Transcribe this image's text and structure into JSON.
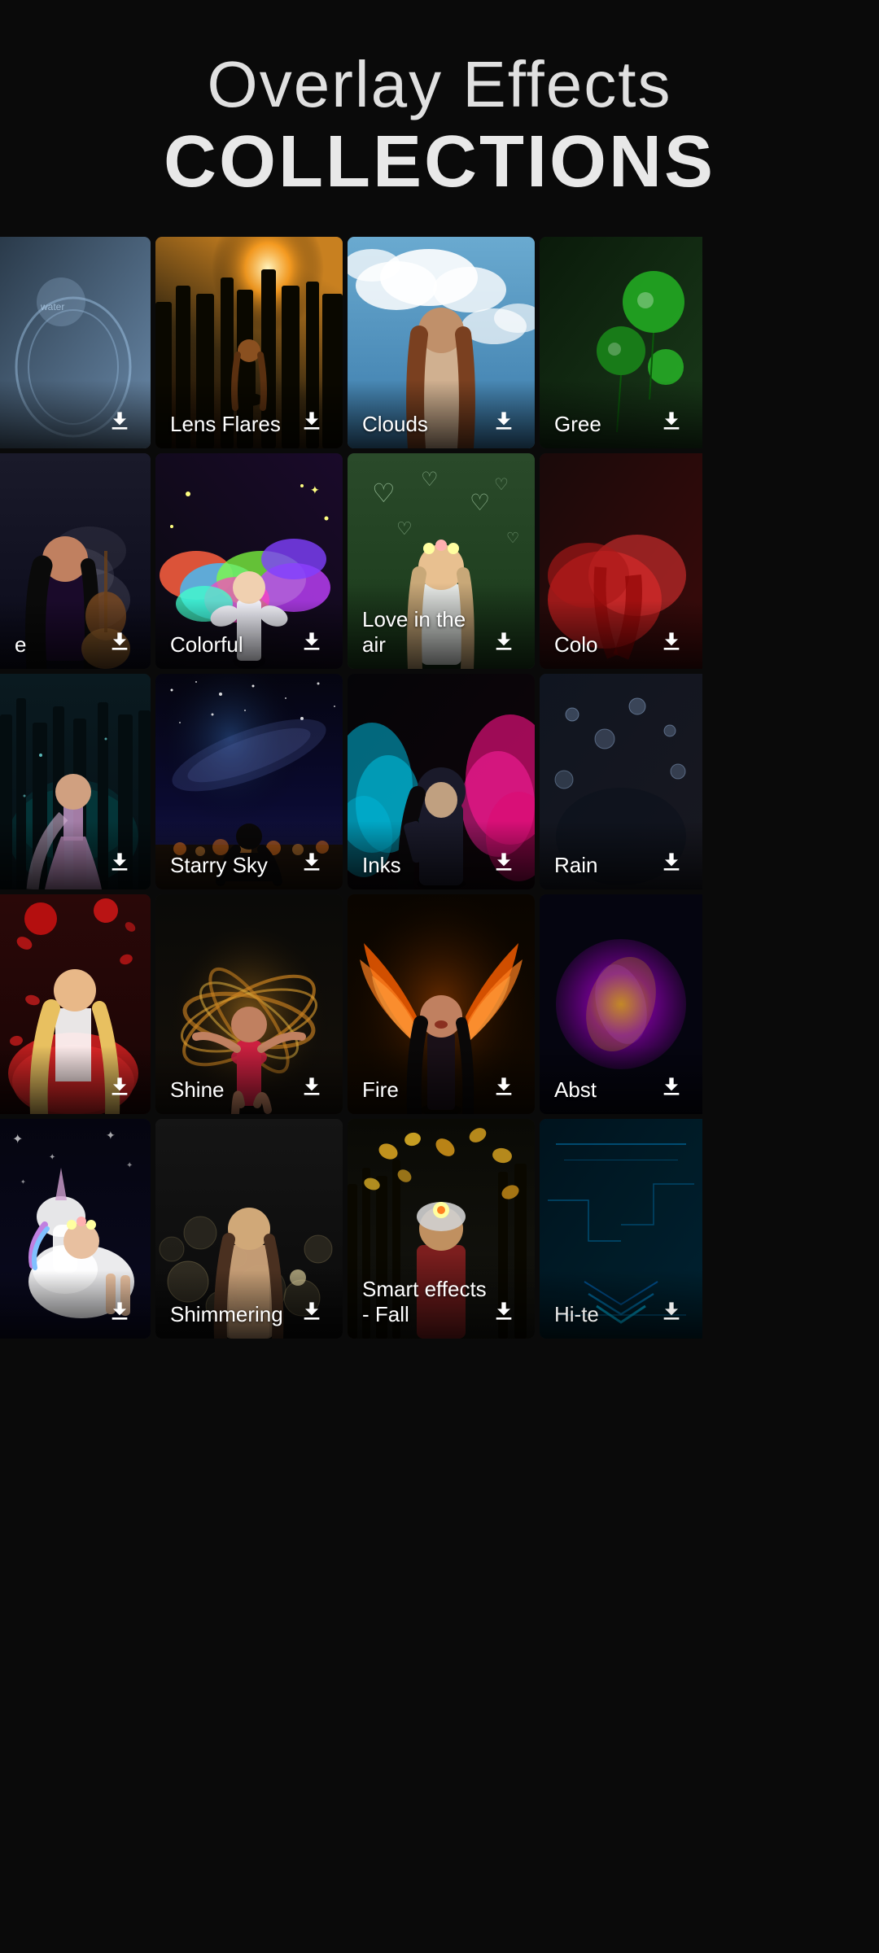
{
  "header": {
    "title": "Overlay Effects",
    "subtitle": "COLLECTIONS"
  },
  "rows": [
    {
      "id": "row1",
      "cards": [
        {
          "id": "water-horse",
          "label": "",
          "color1": "#2a3a4a",
          "color2": "#4a6a8a",
          "type": "water-fantasy",
          "partial": "left"
        },
        {
          "id": "lens-flares",
          "label": "Lens Flares",
          "color1": "#3a2a0a",
          "color2": "#8a5a1a",
          "type": "forest-sun"
        },
        {
          "id": "clouds",
          "label": "Clouds",
          "color1": "#4a7aaa",
          "color2": "#8aaaca",
          "type": "clouds-sky"
        },
        {
          "id": "green",
          "label": "Gree",
          "color1": "#0a2a0a",
          "color2": "#1a4a1a",
          "type": "green-balloons",
          "partial": "right"
        }
      ]
    },
    {
      "id": "row2",
      "cards": [
        {
          "id": "guitar",
          "label": "e",
          "color1": "#1a1a2a",
          "color2": "#2a2a4a",
          "type": "guitar-smoke",
          "partial": "left"
        },
        {
          "id": "colorful",
          "label": "Colorful",
          "color1": "#1a0a2a",
          "color2": "#4a1a6a",
          "type": "colorful-magic"
        },
        {
          "id": "love-in-air",
          "label": "Love in the air",
          "color1": "#2a3a2a",
          "color2": "#4a5a3a",
          "type": "hearts-bokeh"
        },
        {
          "id": "color-splash",
          "label": "Colo",
          "color1": "#2a0a0a",
          "color2": "#5a0a1a",
          "type": "color-smoke",
          "partial": "right"
        }
      ]
    },
    {
      "id": "row3",
      "cards": [
        {
          "id": "fantasy-forest",
          "label": "",
          "color1": "#0a1a1a",
          "color2": "#1a3a3a",
          "type": "teal-forest",
          "partial": "left"
        },
        {
          "id": "starry-sky",
          "label": "Starry Sky",
          "color1": "#0a0a2a",
          "color2": "#1a1a5a",
          "type": "starry-night"
        },
        {
          "id": "inks",
          "label": "Inks",
          "color1": "#1a0a2a",
          "color2": "#3a0a5a",
          "type": "ink-smoke"
        },
        {
          "id": "rain",
          "label": "Rain",
          "color1": "#1a1a2a",
          "color2": "#2a2a3a",
          "type": "rain-drops",
          "partial": "right"
        }
      ]
    },
    {
      "id": "row4",
      "cards": [
        {
          "id": "rose-petals",
          "label": "",
          "color1": "#2a0a0a",
          "color2": "#5a1a1a",
          "type": "rose-petals",
          "partial": "left"
        },
        {
          "id": "shine",
          "label": "Shine",
          "color1": "#1a0a0a",
          "color2": "#3a2a0a",
          "type": "light-spin"
        },
        {
          "id": "fire",
          "label": "Fire",
          "color1": "#1a0a00",
          "color2": "#3a1a00",
          "type": "fire-wings"
        },
        {
          "id": "abstract",
          "label": "Abst",
          "color1": "#0a0a1a",
          "color2": "#1a0a2a",
          "type": "abstract-light",
          "partial": "right"
        }
      ]
    },
    {
      "id": "row5",
      "cards": [
        {
          "id": "unicorn",
          "label": "",
          "color1": "#0a0a1a",
          "color2": "#1a1a3a",
          "type": "unicorn-fantasy",
          "partial": "left"
        },
        {
          "id": "shimmering",
          "label": "Shimmering",
          "color1": "#1a1a1a",
          "color2": "#2a2a2a",
          "type": "bokeh-girl"
        },
        {
          "id": "smart-effects-fall",
          "label": "Smart effects - Fall",
          "color1": "#1a1a0a",
          "color2": "#2a2a1a",
          "type": "autumn-leaves"
        },
        {
          "id": "hi-tech",
          "label": "Hi-te",
          "color1": "#0a1a1a",
          "color2": "#0a2a3a",
          "type": "hi-tech",
          "partial": "right"
        }
      ]
    }
  ],
  "download_icon_unicode": "⬇",
  "colors": {
    "bg": "#0a0a0a",
    "card_bg": "#1a1a1a",
    "text": "#ffffff",
    "label_gradient": "rgba(0,0,0,0.75)"
  }
}
